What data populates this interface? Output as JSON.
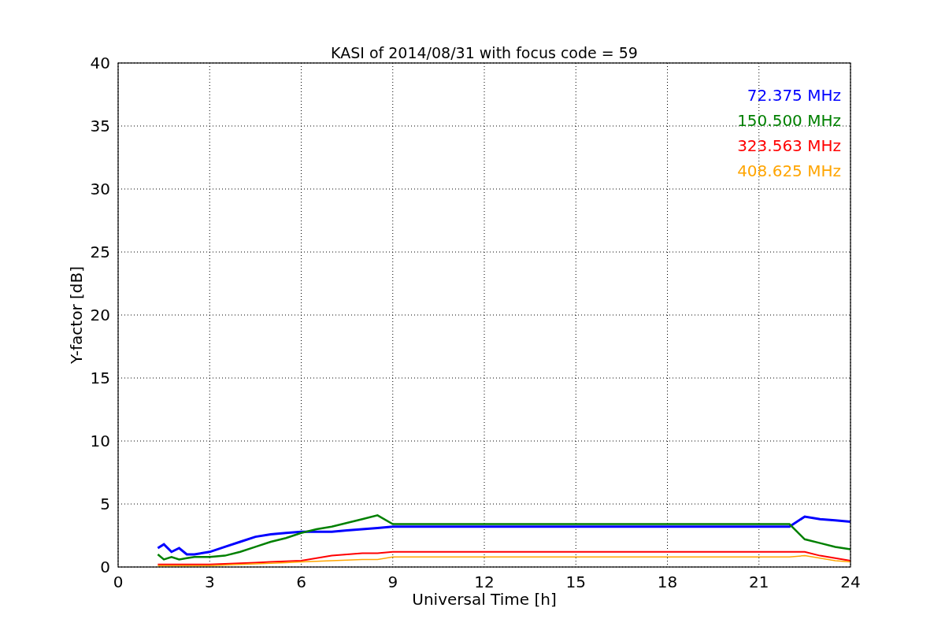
{
  "chart_data": {
    "type": "line",
    "title": "KASI of 2014/08/31 with focus code = 59",
    "xlabel": "Universal Time [h]",
    "ylabel": "Y-factor [dB]",
    "x": [
      1.3,
      1.5,
      1.75,
      2.0,
      2.25,
      2.5,
      3,
      3.5,
      4,
      4.5,
      5,
      5.5,
      6,
      6.5,
      7,
      7.5,
      8,
      8.5,
      9,
      22,
      22.5,
      23,
      23.5,
      24
    ],
    "series": [
      {
        "name": "72.375 MHz",
        "color": "#0000ff",
        "values": [
          1.5,
          1.8,
          1.2,
          1.5,
          1.0,
          1.0,
          1.2,
          1.6,
          2.0,
          2.4,
          2.6,
          2.7,
          2.8,
          2.8,
          2.8,
          2.9,
          3.0,
          3.1,
          3.2,
          3.2,
          4.0,
          3.8,
          3.7,
          3.6
        ]
      },
      {
        "name": "150.500 MHz",
        "color": "#008000",
        "values": [
          1.0,
          0.6,
          0.8,
          0.6,
          0.7,
          0.8,
          0.8,
          0.9,
          1.2,
          1.6,
          2.0,
          2.3,
          2.7,
          3.0,
          3.2,
          3.5,
          3.8,
          4.1,
          3.4,
          3.4,
          2.2,
          1.9,
          1.6,
          1.4
        ]
      },
      {
        "name": "323.563 MHz",
        "color": "#ff0000",
        "values": [
          0.2,
          0.2,
          0.2,
          0.2,
          0.2,
          0.2,
          0.2,
          0.25,
          0.3,
          0.35,
          0.4,
          0.45,
          0.5,
          0.7,
          0.9,
          1.0,
          1.1,
          1.1,
          1.2,
          1.2,
          1.2,
          0.9,
          0.7,
          0.5
        ]
      },
      {
        "name": "408.625 MHz",
        "color": "#ffa500",
        "values": [
          0.1,
          0.1,
          0.1,
          0.1,
          0.1,
          0.1,
          0.1,
          0.15,
          0.2,
          0.25,
          0.3,
          0.35,
          0.4,
          0.45,
          0.5,
          0.55,
          0.6,
          0.6,
          0.8,
          0.8,
          0.9,
          0.7,
          0.5,
          0.4
        ]
      }
    ],
    "grid": true,
    "xlim": [
      0,
      24
    ],
    "ylim": [
      0,
      40
    ],
    "xticks": [
      0,
      3,
      6,
      9,
      12,
      15,
      18,
      21,
      24
    ],
    "yticks": [
      0,
      5,
      10,
      15,
      20,
      25,
      30,
      35,
      40
    ]
  }
}
